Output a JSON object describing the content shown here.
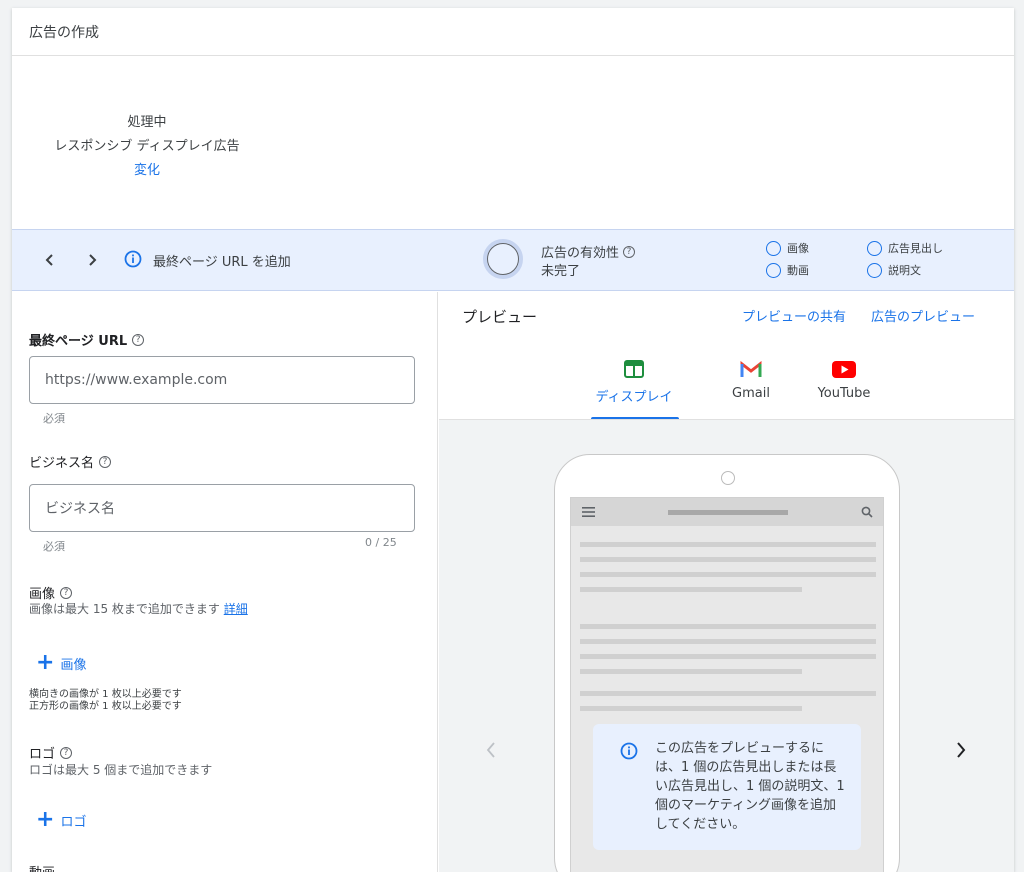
{
  "header": {
    "title": "広告の作成"
  },
  "status": {
    "processing": "処理中",
    "ad_type": "レスポンシブ ディスプレイ広告",
    "change_link": "変化"
  },
  "bar": {
    "info_label": "最終ページ URL を追加",
    "effectiveness_title": "広告の有効性",
    "effectiveness_status": "未完了",
    "checklist": [
      "画像",
      "動画",
      "広告見出し",
      "説明文"
    ]
  },
  "form": {
    "url_label": "最終ページ URL",
    "url_placeholder": "https://www.example.com",
    "url_hint": "必須",
    "business_label": "ビジネス名",
    "business_placeholder": "ビジネス名",
    "business_hint": "必須",
    "business_counter": "0 / 25",
    "images_label": "画像",
    "images_sub": "画像は最大 15 枚まで追加できます",
    "images_detail_link": "詳細",
    "add_image": "画像",
    "image_req_1": "横向きの画像が 1 枚以上必要です",
    "image_req_2": "正方形の画像が 1 枚以上必要です",
    "logo_label": "ロゴ",
    "logo_sub": "ロゴは最大 5 個まで追加できます",
    "add_logo": "ロゴ",
    "video_label": "動画"
  },
  "preview": {
    "title": "プレビュー",
    "share_link": "プレビューの共有",
    "ad_preview_link": "広告のプレビュー",
    "tabs": [
      "ディスプレイ",
      "Gmail",
      "YouTube"
    ],
    "message": "この広告をプレビューするには、1 個の広告見出しまたは長い広告見出し、1 個の説明文、1 個のマーケティング画像を追加してください。"
  },
  "colors": {
    "accent": "#1a73e8",
    "bar_bg": "#e8f0fe",
    "gmail_red": "#ea4335",
    "display_green": "#1e8e3e",
    "youtube_red": "#ff0000"
  }
}
